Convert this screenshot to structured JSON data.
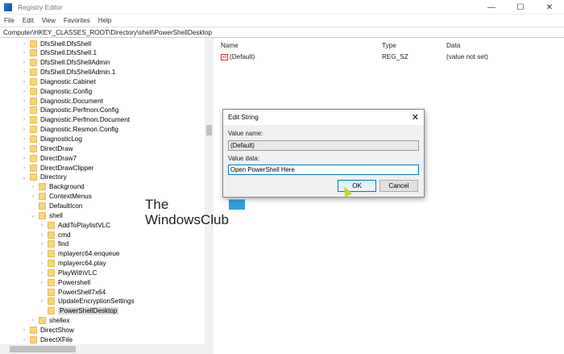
{
  "window": {
    "title": "Registry Editor",
    "controls": [
      "—",
      "☐",
      "✕"
    ]
  },
  "menu": [
    "File",
    "Edit",
    "View",
    "Favorites",
    "Help"
  ],
  "address": "Computer\\HKEY_CLASSES_ROOT\\Directory\\shell\\PowerShellDesktop",
  "tree": [
    {
      "label": "DfsShell.DfsShell",
      "level": 0,
      "chev": ">"
    },
    {
      "label": "DfsShell.DfsShell.1",
      "level": 0,
      "chev": ">"
    },
    {
      "label": "DfsShell.DfsShellAdmin",
      "level": 0,
      "chev": ">"
    },
    {
      "label": "DfsShell.DfsShellAdmin.1",
      "level": 0,
      "chev": ">"
    },
    {
      "label": "Diagnostic.Cabinet",
      "level": 0,
      "chev": ">"
    },
    {
      "label": "Diagnostic.Config",
      "level": 0,
      "chev": ">"
    },
    {
      "label": "Diagnostic.Document",
      "level": 0,
      "chev": ">"
    },
    {
      "label": "Diagnostic.Perfmon.Config",
      "level": 0,
      "chev": ">"
    },
    {
      "label": "Diagnostic.Perfmon.Document",
      "level": 0,
      "chev": ">"
    },
    {
      "label": "Diagnostic.Resmon.Config",
      "level": 0,
      "chev": ">"
    },
    {
      "label": "DiagnosticLog",
      "level": 0,
      "chev": ">"
    },
    {
      "label": "DirectDraw",
      "level": 0,
      "chev": ">"
    },
    {
      "label": "DirectDraw7",
      "level": 0,
      "chev": ">"
    },
    {
      "label": "DirectDrawClipper",
      "level": 0,
      "chev": ">"
    },
    {
      "label": "Directory",
      "level": 0,
      "chev": "v"
    },
    {
      "label": "Background",
      "level": 1,
      "chev": ">"
    },
    {
      "label": "ContextMenus",
      "level": 1,
      "chev": ">"
    },
    {
      "label": "DefaultIcon",
      "level": 1,
      "chev": ""
    },
    {
      "label": "shell",
      "level": 1,
      "chev": "v"
    },
    {
      "label": "AddToPlaylistVLC",
      "level": 2,
      "chev": ">"
    },
    {
      "label": "cmd",
      "level": 2,
      "chev": ">"
    },
    {
      "label": "find",
      "level": 2,
      "chev": ">"
    },
    {
      "label": "mplayerc64.enqueue",
      "level": 2,
      "chev": ">"
    },
    {
      "label": "mplayerc64.play",
      "level": 2,
      "chev": ">"
    },
    {
      "label": "PlayWithVLC",
      "level": 2,
      "chev": ">"
    },
    {
      "label": "Powershell",
      "level": 2,
      "chev": ">"
    },
    {
      "label": "PowerShell7x64",
      "level": 2,
      "chev": ""
    },
    {
      "label": "UpdateEncryptionSettings",
      "level": 2,
      "chev": ">"
    },
    {
      "label": "PowerShellDesktop",
      "level": 2,
      "chev": "",
      "selected": true
    },
    {
      "label": "shellex",
      "level": 1,
      "chev": ">"
    },
    {
      "label": "DirectShow",
      "level": 0,
      "chev": ">"
    },
    {
      "label": "DirectXFile",
      "level": 0,
      "chev": ">"
    }
  ],
  "list": {
    "headers": {
      "name": "Name",
      "type": "Type",
      "data": "Data"
    },
    "rows": [
      {
        "name": "(Default)",
        "type": "REG_SZ",
        "data": "(value not set)",
        "icon": "ab"
      }
    ]
  },
  "dialog": {
    "title": "Edit String",
    "close": "✕",
    "value_name_label": "Value name:",
    "value_name": "(Default)",
    "value_data_label": "Value data:",
    "value_data": "Open PowerShell Here",
    "ok": "OK",
    "cancel": "Cancel"
  },
  "watermark": {
    "line1": "The",
    "line2": "WindowsClub"
  }
}
